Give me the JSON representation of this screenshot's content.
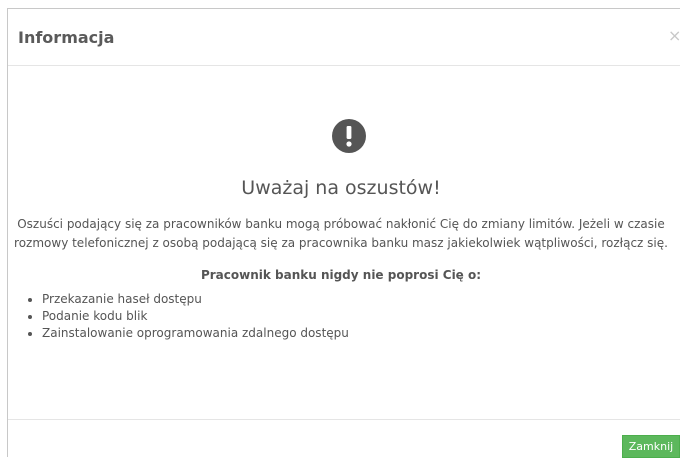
{
  "modal": {
    "title": "Informacja",
    "close_glyph": "×"
  },
  "alert": {
    "icon": "exclamation-circle-icon",
    "icon_color": "#555555",
    "title": "Uważaj na oszustów!",
    "paragraph_lines": [
      "Oszuści podający się za pracowników banku mogą próbować nakłonić Cię do zmiany limitów. Jeżeli w czasie",
      "rozmowy telefonicznej z osobą podającą się za pracownika banku masz jakiekolwiek wątpliwości, rozłącz się."
    ],
    "never_title": "Pracownik banku nigdy nie poprosi Cię o:",
    "items": [
      "Przekazanie haseł dostępu",
      "Podanie kodu blik",
      "Zainstalowanie oprogramowania zdalnego dostępu"
    ]
  },
  "footer": {
    "close_button_label": "Zamknij",
    "close_button_color": "#5cb85c"
  }
}
